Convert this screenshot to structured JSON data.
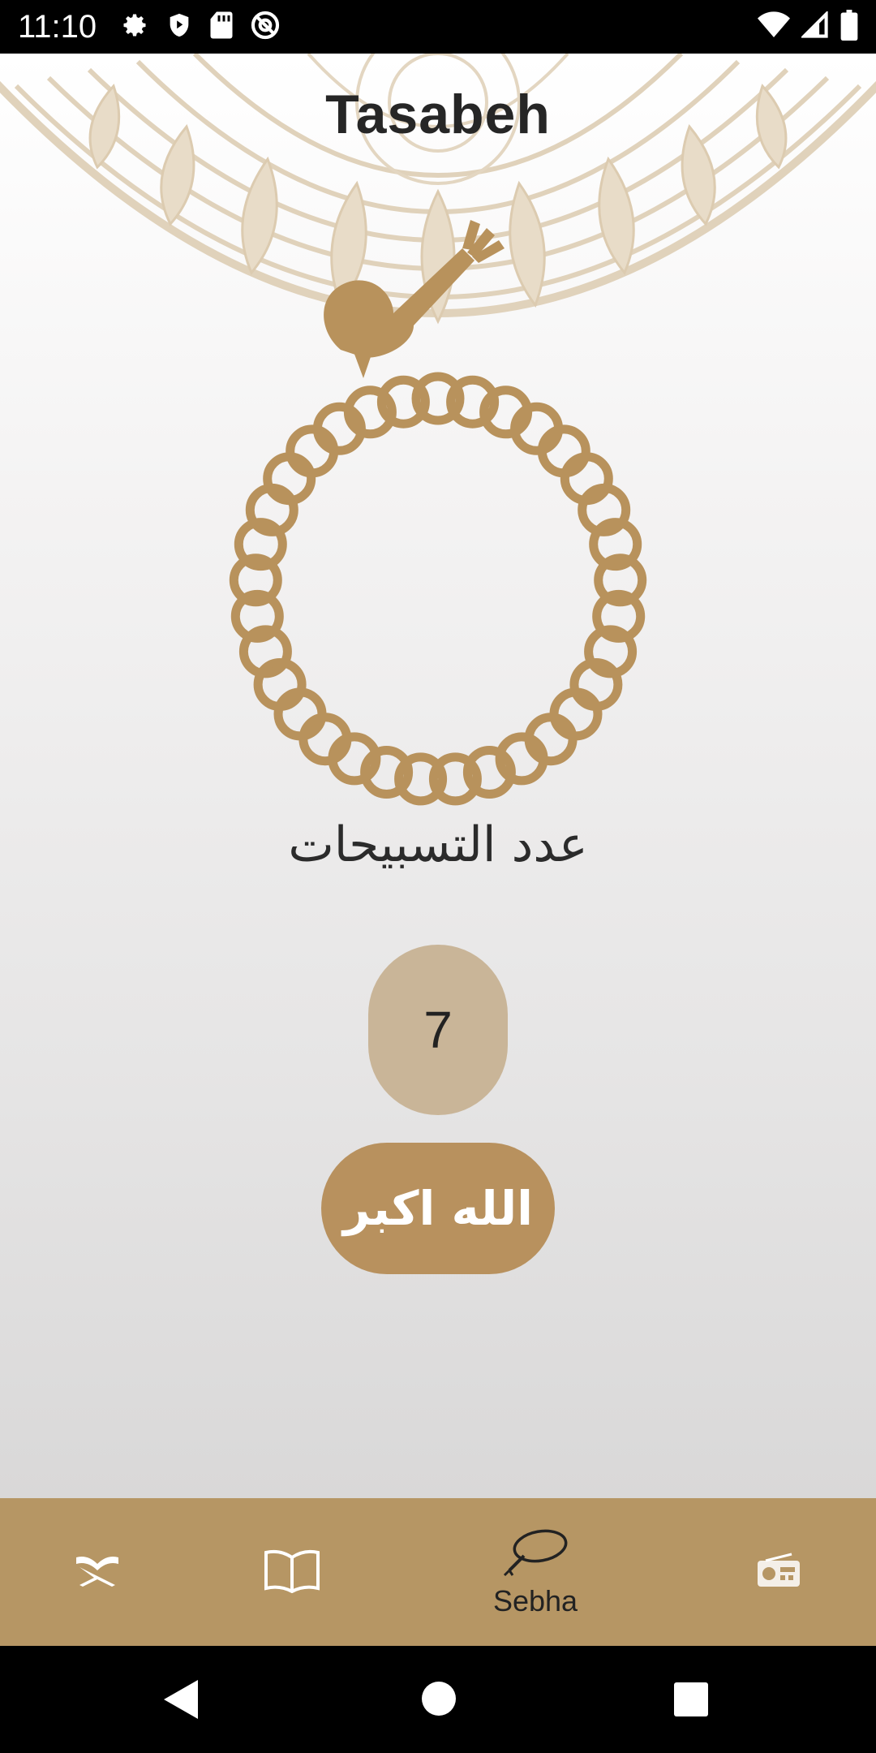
{
  "status_bar": {
    "time": "11:10",
    "left_icons": [
      "gear-icon",
      "shield-icon",
      "sd-card-icon",
      "no-location-icon"
    ],
    "right_icons": [
      "wifi-icon",
      "signal-icon",
      "battery-icon"
    ]
  },
  "page": {
    "title": "Tasabeh"
  },
  "sebha": {
    "count_label": "عدد التسبيحات",
    "count": "7",
    "tasbeeh_button_label": "الله اكبر"
  },
  "bottom_nav": {
    "items": [
      {
        "icon": "quran-stand-icon",
        "label": ""
      },
      {
        "icon": "open-book-icon",
        "label": ""
      },
      {
        "icon": "sebha-icon",
        "label": "Sebha",
        "active": true
      },
      {
        "icon": "radio-icon",
        "label": ""
      }
    ]
  },
  "system_nav": {
    "buttons": [
      "back-icon",
      "home-icon",
      "recents-icon"
    ]
  },
  "colors": {
    "accent": "#b69664",
    "button": "#b8915e",
    "counter_bg": "#c9b598",
    "beads": "#b8925c",
    "mandala": "#e3d6c1"
  }
}
